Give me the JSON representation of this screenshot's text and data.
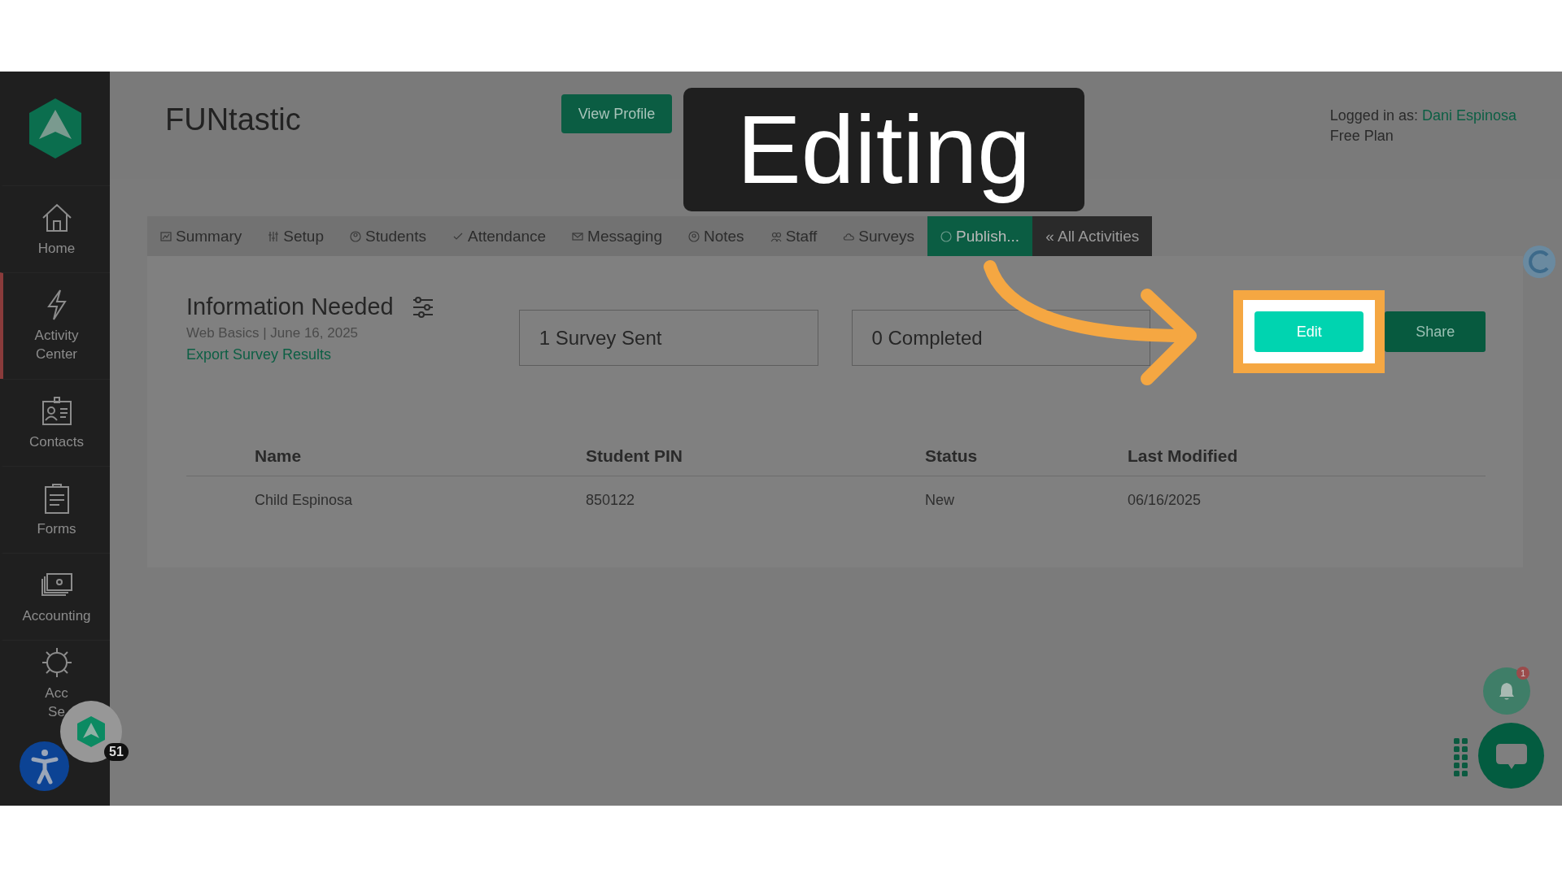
{
  "overlay": {
    "caption": "Editing"
  },
  "sidebar": {
    "items": [
      {
        "lines": [
          "Home"
        ],
        "selected": false
      },
      {
        "lines": [
          "Activity",
          "Center"
        ],
        "selected": true
      },
      {
        "lines": [
          "Contacts"
        ],
        "selected": false
      },
      {
        "lines": [
          "Forms"
        ],
        "selected": false
      },
      {
        "lines": [
          "Accounting"
        ],
        "selected": false
      },
      {
        "lines": [
          "Acc",
          "Se"
        ],
        "selected": false
      }
    ]
  },
  "header": {
    "title": "FUNtastic",
    "view_profile": "View Profile",
    "login_prefix": "Logged in as:",
    "user": "Dani Espinosa",
    "plan": "Free Plan"
  },
  "tabs": [
    {
      "label": "Summary",
      "kind": "tab",
      "selected": false
    },
    {
      "label": "Setup",
      "kind": "tab",
      "selected": false
    },
    {
      "label": "Students",
      "kind": "tab",
      "selected": false
    },
    {
      "label": "Attendance",
      "kind": "tab",
      "selected": false
    },
    {
      "label": "Messaging",
      "kind": "tab",
      "selected": false
    },
    {
      "label": "Notes",
      "kind": "tab",
      "selected": false
    },
    {
      "label": "Staff",
      "kind": "tab",
      "selected": false
    },
    {
      "label": "Surveys",
      "kind": "tab",
      "selected": false
    },
    {
      "label": "Publish...",
      "kind": "tab",
      "selected": true
    },
    {
      "label": "« All Activities",
      "kind": "link",
      "selected": false
    }
  ],
  "survey": {
    "title": "Information Needed",
    "subtitle": "Web Basics | June 16, 2025",
    "export_link": "Export Survey Results",
    "stats": [
      "1 Survey Sent",
      "0 Completed"
    ],
    "edit_button": "Edit",
    "share_button": "Share"
  },
  "table": {
    "columns": [
      "Name",
      "Student PIN",
      "Status",
      "Last Modified"
    ],
    "rows": [
      [
        "Child Espinosa",
        "850122",
        "New",
        "06/16/2025"
      ]
    ]
  },
  "widgets": {
    "notification_count": "1",
    "launcher_count": "51"
  }
}
